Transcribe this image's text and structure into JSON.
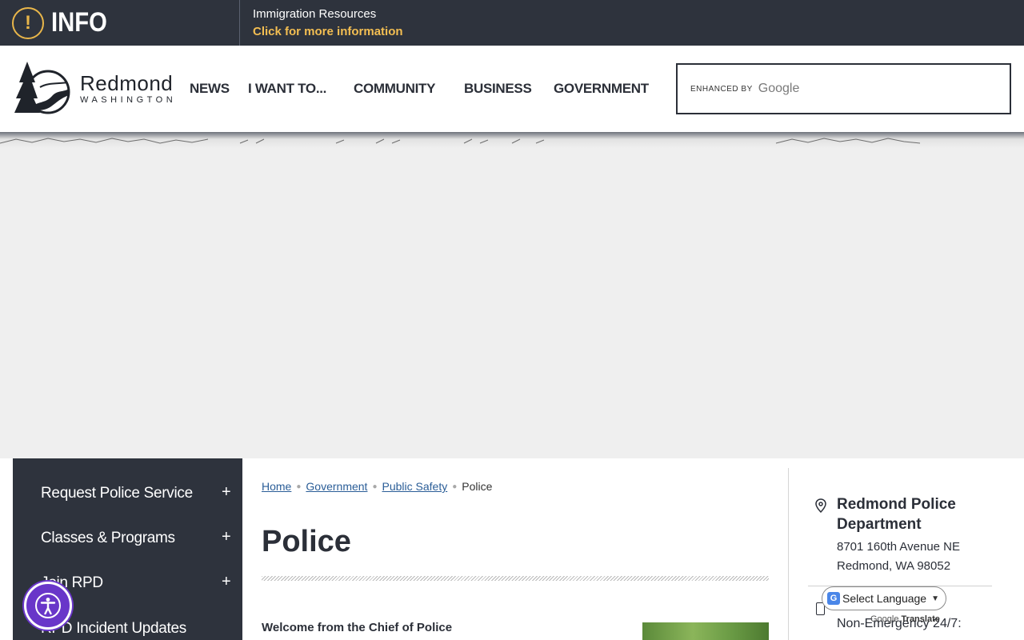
{
  "alert": {
    "label": "INFO",
    "title": "Immigration Resources",
    "link": "Click for more information",
    "icon": "exclamation-icon",
    "accent_color": "#f3be52"
  },
  "header": {
    "logo_name": "Redmond",
    "logo_sub": "WASHINGTON",
    "nav": [
      "NEWS",
      "I WANT TO...",
      "COMMUNITY",
      "BUSINESS",
      "GOVERNMENT"
    ],
    "search": {
      "enhanced_by": "ENHANCED BY",
      "brand": "Google"
    }
  },
  "sidebar": {
    "items": [
      {
        "label": "Request Police Service",
        "toggle": "+"
      },
      {
        "label": "Classes & Programs",
        "toggle": "+"
      },
      {
        "label": "Join RPD",
        "toggle": "+"
      },
      {
        "label": "RPD Incident Updates"
      }
    ],
    "bg_color": "#2e333d"
  },
  "breadcrumb": {
    "links": [
      "Home",
      "Government",
      "Public Safety"
    ],
    "current": "Police"
  },
  "main": {
    "title": "Police",
    "welcome": "Welcome from the Chief of Police"
  },
  "contact": {
    "name": "Redmond Police Department",
    "address_line1": "8701 160th Avenue NE",
    "address_line2": "Redmond, WA 98052",
    "nonemergency": "Non-Emergency 24/7:"
  },
  "translate": {
    "label": "Select Language",
    "powered_prefix": "Google",
    "powered_suffix": "Translate"
  }
}
